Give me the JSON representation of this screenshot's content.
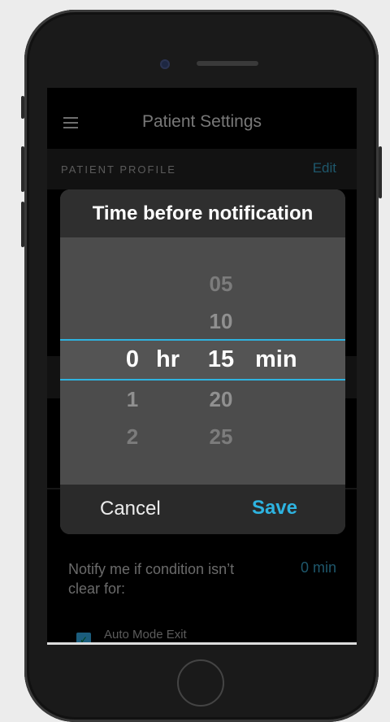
{
  "nav": {
    "title": "Patient Settings",
    "menu_icon": "hamburger-menu-icon"
  },
  "profile_section": {
    "label": "PATIENT PROFILE",
    "edit_label": "Edit"
  },
  "notify": {
    "text": "Notify me if condition isn’t clear for:",
    "value": "0 min"
  },
  "auto_mode": {
    "label": "Auto Mode Exit",
    "checked": true
  },
  "dialog": {
    "title": "Time before notification",
    "hours": {
      "values": [
        "",
        "",
        "0",
        "1",
        "2"
      ],
      "selected": "0",
      "unit": "hr"
    },
    "minutes": {
      "values": [
        "05",
        "10",
        "15",
        "20",
        "25"
      ],
      "selected": "15",
      "unit": "min"
    },
    "cancel_label": "Cancel",
    "save_label": "Save"
  },
  "colors": {
    "accent": "#2eb3e0",
    "link": "#2f86a5",
    "dialog_bg": "#4d4d4d"
  }
}
